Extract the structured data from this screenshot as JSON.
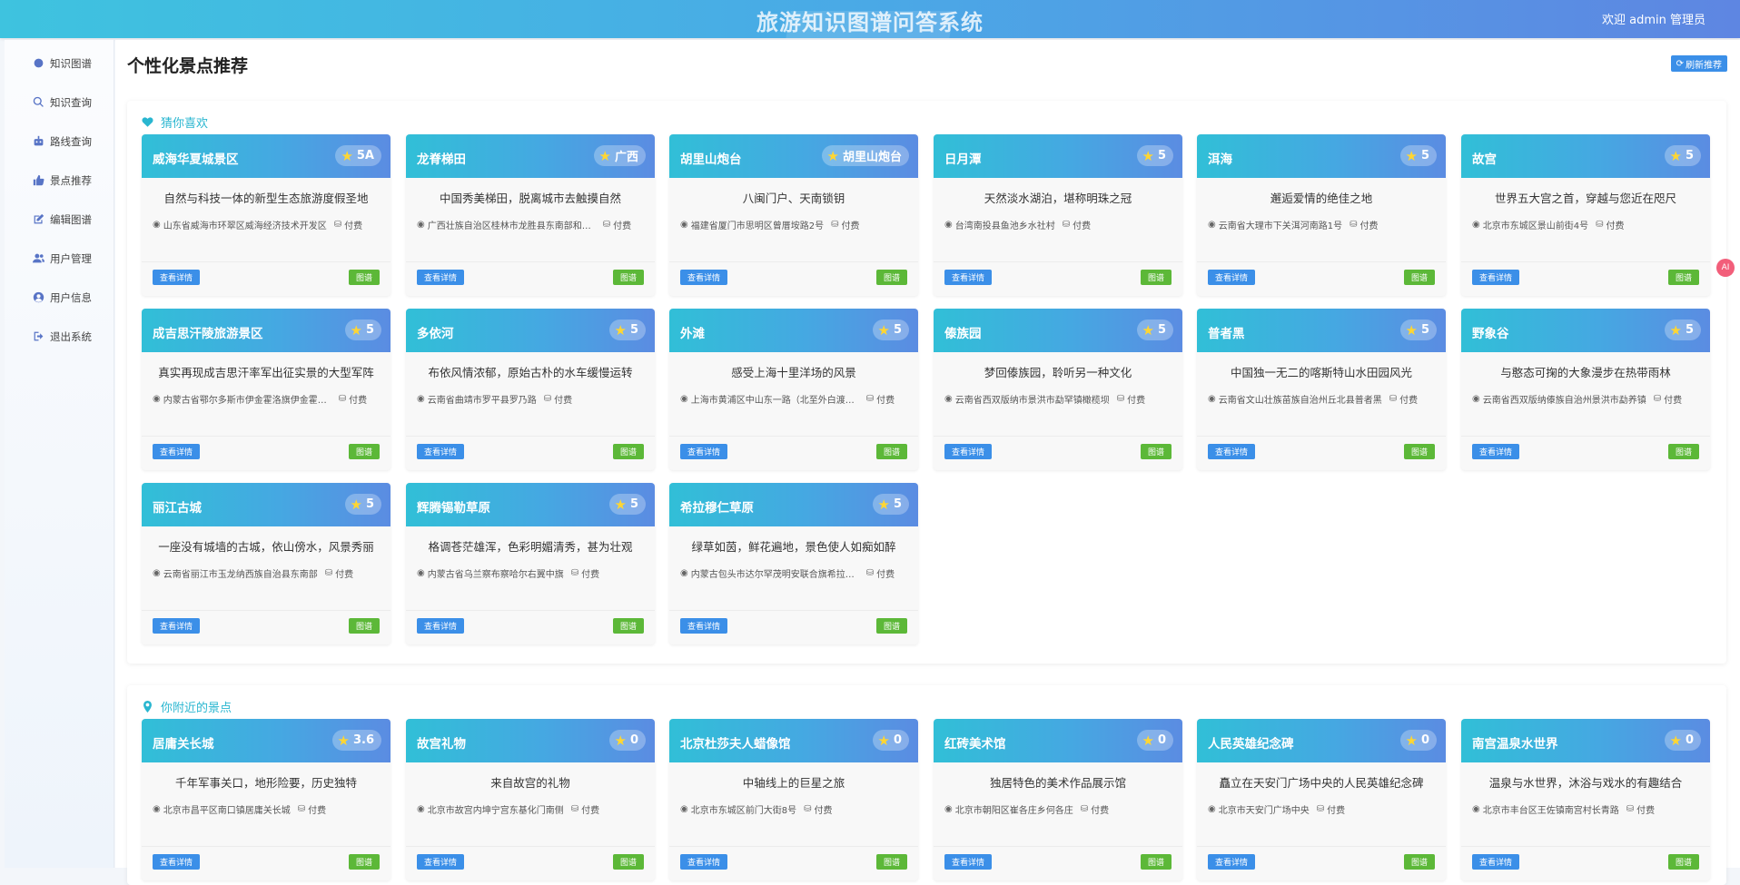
{
  "header": {
    "title": "旅游知识图谱问答系统",
    "welcome": "欢迎 admin 管理员"
  },
  "sidebar": {
    "items": [
      {
        "label": "知识图谱",
        "icon": "circle-icon"
      },
      {
        "label": "知识查询",
        "icon": "search-icon"
      },
      {
        "label": "路线查询",
        "icon": "robot-icon"
      },
      {
        "label": "景点推荐",
        "icon": "thumbs-up-icon"
      },
      {
        "label": "编辑图谱",
        "icon": "edit-icon"
      },
      {
        "label": "用户管理",
        "icon": "users-icon"
      },
      {
        "label": "用户信息",
        "icon": "user-circle-icon"
      },
      {
        "label": "退出系统",
        "icon": "logout-icon"
      }
    ]
  },
  "main": {
    "title": "个性化景点推荐",
    "refresh_label": "刷新推荐",
    "buttons": {
      "detail": "查看详情",
      "map": "图谱"
    }
  },
  "guess": {
    "title": "猜你喜欢",
    "cards": [
      {
        "name": "威海华夏城景区",
        "badge": "5A",
        "desc": "自然与科技一体的新型生态旅游度假圣地",
        "address": "山东省威海市环翠区威海经济技术开发区",
        "fee": "付费"
      },
      {
        "name": "龙脊梯田",
        "badge": "广西",
        "desc": "中国秀美梯田，脱离城市去触摸自然",
        "address": "广西壮族自治区桂林市龙胜县东南部和平乡",
        "fee": "付费"
      },
      {
        "name": "胡里山炮台",
        "badge": "胡里山炮台",
        "desc": "八闽门户、天南锁钥",
        "address": "福建省厦门市思明区曾厝垵路2号",
        "fee": "付费"
      },
      {
        "name": "日月潭",
        "badge": "5",
        "desc": "天然淡水湖泊，堪称明珠之冠",
        "address": "台湾南投县鱼池乡水社村",
        "fee": "付费"
      },
      {
        "name": "洱海",
        "badge": "5",
        "desc": "邂逅爱情的绝佳之地",
        "address": "云南省大理市下关洱河南路1号",
        "fee": "付费"
      },
      {
        "name": "故宫",
        "badge": "5",
        "desc": "世界五大宫之首，穿越与您近在咫尺",
        "address": "北京市东城区景山前街4号",
        "fee": "付费"
      },
      {
        "name": "成吉思汗陵旅游景区",
        "badge": "5",
        "desc": "真实再现成吉思汗率军出征实景的大型军阵",
        "address": "内蒙古省鄂尔多斯市伊金霍洛旗伊金霍洛镇",
        "fee": "付费"
      },
      {
        "name": "多依河",
        "badge": "5",
        "desc": "布依风情浓郁，原始古朴的水车缓慢运转",
        "address": "云南省曲靖市罗平县罗乃路",
        "fee": "付费"
      },
      {
        "name": "外滩",
        "badge": "5",
        "desc": "感受上海十里洋场的风景",
        "address": "上海市黄浦区中山东一路（北至外白渡桥）",
        "fee": "付费"
      },
      {
        "name": "傣族园",
        "badge": "5",
        "desc": "梦回傣族园，聆听另一种文化",
        "address": "云南省西双版纳市景洪市勐罕镇橄榄坝",
        "fee": "付费"
      },
      {
        "name": "普者黑",
        "badge": "5",
        "desc": "中国独一无二的喀斯特山水田园风光",
        "address": "云南省文山壮族苗族自治州丘北县普者黑",
        "fee": "付费"
      },
      {
        "name": "野象谷",
        "badge": "5",
        "desc": "与憨态可掬的大象漫步在热带雨林",
        "address": "云南省西双版纳傣族自治州景洪市勐养镇",
        "fee": "付费"
      },
      {
        "name": "丽江古城",
        "badge": "5",
        "desc": "一座没有城墙的古城，依山傍水，风景秀丽",
        "address": "云南省丽江市玉龙纳西族自治县东南部",
        "fee": "付费"
      },
      {
        "name": "辉腾锡勒草原",
        "badge": "5",
        "desc": "格调苍茫雄浑，色彩明媚清秀，甚为壮观",
        "address": "内蒙古省乌兰察布察哈尔右翼中旗",
        "fee": "付费"
      },
      {
        "name": "希拉穆仁草原",
        "badge": "5",
        "desc": "绿草如茵，鲜花遍地，景色使人如痴如醉",
        "address": "内蒙古包头市达尔罕茂明安联合旗希拉穆仁镇",
        "fee": "付费"
      }
    ]
  },
  "nearby": {
    "title": "你附近的景点",
    "cards": [
      {
        "name": "居庸关长城",
        "badge": "3.6",
        "desc": "千年军事关口，地形险要，历史独特",
        "address": "北京市昌平区南口镇居庸关长城",
        "fee": "付费"
      },
      {
        "name": "故宫礼物",
        "badge": "0",
        "desc": "来自故宫的礼物",
        "address": "北京市故宫内坤宁宫东基化门南侧",
        "fee": "付费"
      },
      {
        "name": "北京杜莎夫人蜡像馆",
        "badge": "0",
        "desc": "中轴线上的巨星之旅",
        "address": "北京市东城区前门大街8号",
        "fee": "付费"
      },
      {
        "name": "红砖美术馆",
        "badge": "0",
        "desc": "独居特色的美术作品展示馆",
        "address": "北京市朝阳区崔各庄乡何各庄",
        "fee": "付费"
      },
      {
        "name": "人民英雄纪念碑",
        "badge": "0",
        "desc": "矗立在天安门广场中央的人民英雄纪念碑",
        "address": "北京市天安门广场中央",
        "fee": "付费"
      },
      {
        "name": "南宫温泉水世界",
        "badge": "0",
        "desc": "温泉与水世界，沐浴与戏水的有趣结合",
        "address": "北京市丰台区王佐镇南宫村长青路",
        "fee": "付费"
      }
    ]
  },
  "float_avatar": "AI"
}
